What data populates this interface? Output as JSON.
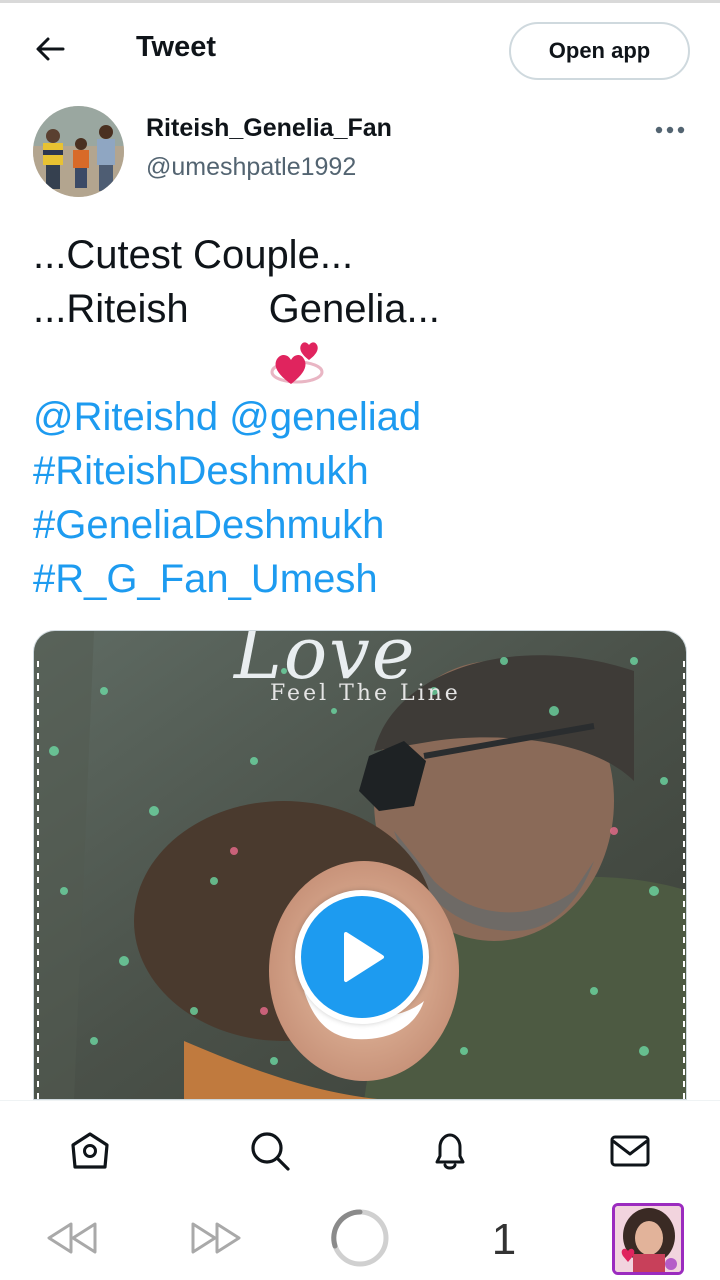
{
  "header": {
    "title": "Tweet",
    "open_app_label": "Open app",
    "back_icon": "arrow-left-icon"
  },
  "author": {
    "display_name": "Riteish_Genelia_Fan",
    "handle": "@umeshpatle1992",
    "more_icon": "more-dots-icon"
  },
  "tweet": {
    "line1": "...Cutest Couple...",
    "line2_before": "...Riteish",
    "line2_emoji": "revolving-hearts",
    "line2_after": "Genelia...",
    "mentions": "@Riteishd @geneliad",
    "hashtags": [
      "#RiteishDeshmukh",
      "#GeneliaDeshmukh",
      "#R_G_Fan_Umesh"
    ]
  },
  "media": {
    "overlay_title": "Love",
    "overlay_subtitle": "Feel The Line",
    "play_icon": "play-icon"
  },
  "bottom_nav": {
    "items": [
      "home-icon",
      "search-icon",
      "notifications-bell-icon",
      "messages-envelope-icon"
    ]
  },
  "browser_bar": {
    "tab_count": "1",
    "items": [
      "rewind-icon",
      "fast-forward-icon",
      "loading-circle-icon",
      "tab-count",
      "profile-thumbnail"
    ]
  },
  "colors": {
    "link": "#1d9bf0",
    "text": "#0f1419",
    "secondary_text": "#536471",
    "border": "#cfd9de",
    "accent_purple": "#9b2bbf"
  }
}
